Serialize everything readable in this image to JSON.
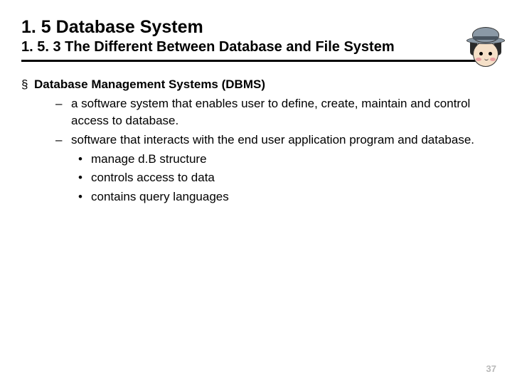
{
  "title": "1. 5 Database System",
  "subtitle": "1. 5. 3 The Different Between Database and File System",
  "content": {
    "heading": "Database Management Systems (DBMS)",
    "points": [
      "a software system that enables user to define, create, maintain and control access to database.",
      "software that interacts with the end user application program and database."
    ],
    "subpoints": [
      "manage d.B structure",
      "controls access to data",
      "contains query languages"
    ]
  },
  "page_number": "37"
}
